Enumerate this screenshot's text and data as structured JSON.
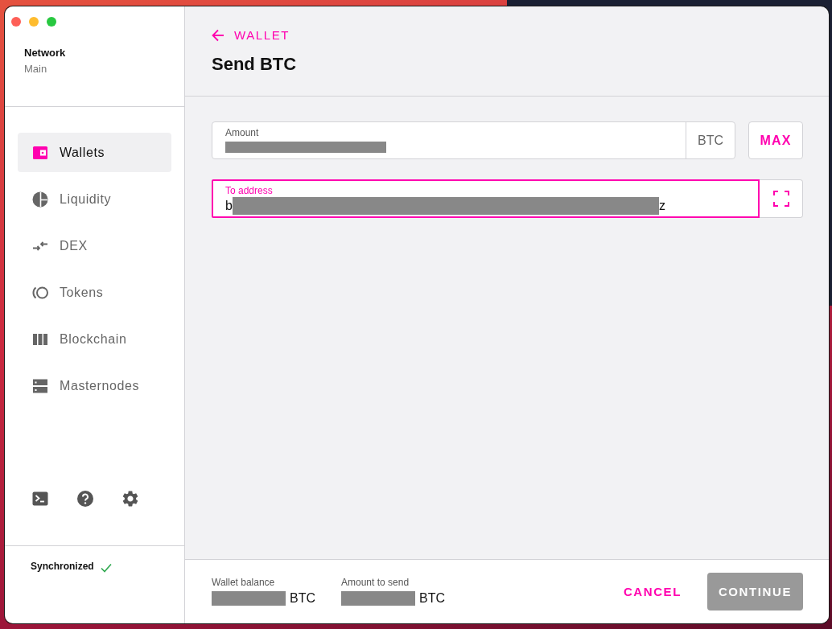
{
  "sidebar": {
    "network": {
      "label": "Network",
      "value": "Main"
    },
    "items": [
      {
        "kind": "wallet",
        "label": "Wallets",
        "selected": true
      },
      {
        "kind": "liquidity",
        "label": "Liquidity",
        "selected": false
      },
      {
        "kind": "dex",
        "label": "DEX",
        "selected": false
      },
      {
        "kind": "tokens",
        "label": "Tokens",
        "selected": false
      },
      {
        "kind": "blockchain",
        "label": "Blockchain",
        "selected": false
      },
      {
        "kind": "masternodes",
        "label": "Masternodes",
        "selected": false
      }
    ],
    "status": {
      "label": "Synchronized",
      "synced": true
    }
  },
  "header": {
    "back_label": "WALLET",
    "title": "Send BTC"
  },
  "form": {
    "amount": {
      "label": "Amount",
      "unit": "BTC"
    },
    "max_button": "MAX",
    "to_address": {
      "label": "To address",
      "value_start": "b",
      "value_end": "z",
      "focused": true
    }
  },
  "footer": {
    "summary": [
      {
        "label": "Wallet balance",
        "unit": "BTC"
      },
      {
        "label": "Amount to send",
        "unit": "BTC"
      }
    ],
    "cancel": "CANCEL",
    "continue": {
      "label": "CONTINUE",
      "disabled": true
    }
  }
}
